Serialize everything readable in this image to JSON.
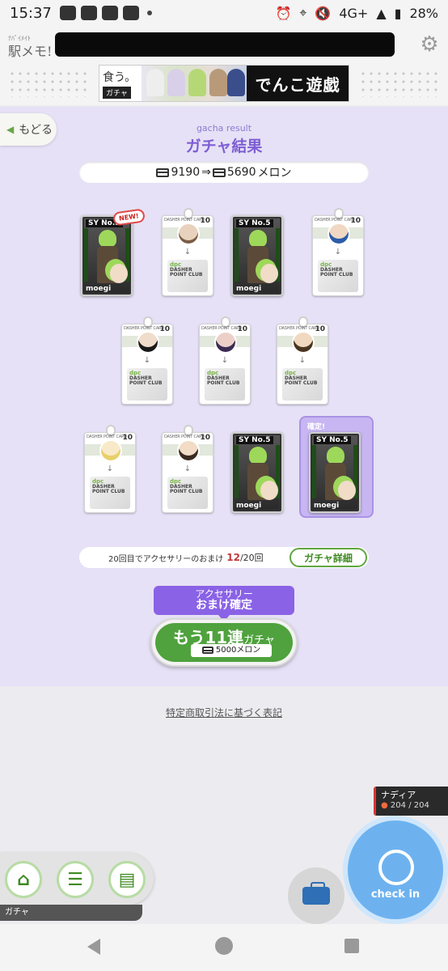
{
  "status": {
    "time": "15:37",
    "network": "4G+",
    "battery": "28%"
  },
  "header": {
    "logo_main": "駅メモ!",
    "logo_sub": "ﾅﾊﾟｲﾒｲﾄ"
  },
  "banner": {
    "left_text": "食う。",
    "left_tag": "ガチャ",
    "right_text": "でんこ遊戯"
  },
  "nav": {
    "back_label": "もどる"
  },
  "result": {
    "subtitle": "gacha result",
    "title": "ガチャ結果",
    "meron_before": "9190",
    "arrow": "⇒",
    "meron_after": "5690",
    "meron_unit": "メロン"
  },
  "cards": {
    "sy_label": "SY",
    "sy_no": "No.5",
    "chara_name": "moegi",
    "dash_header": "DASHER POINT CARD",
    "dash_value": "10",
    "dpc_title": "DASHER POINT CLUB",
    "dpc_short": "dpc",
    "new_tag": "NEW!",
    "guarantee_tag": "確定!"
  },
  "bonus": {
    "text": "20回目でアクセサリーのおまけ",
    "count": "12",
    "total": "/20回",
    "detail_button": "ガチャ詳細"
  },
  "gacha": {
    "accessory_line1": "アクセサリー",
    "accessory_line2": "おまけ確定",
    "button_main": "もう11連",
    "button_suffix": "ガチャ",
    "cost": "5000メロン"
  },
  "legal_link": "特定商取引法に基づく表記",
  "partner": {
    "name": "ナディア",
    "hp": "204 / 204"
  },
  "checkin_label": "check in",
  "bottom_label": "ガチャ",
  "colors": {
    "accent_purple": "#7e5ed4",
    "accent_green": "#4fa23d",
    "checkin_blue": "#6db2ef"
  }
}
